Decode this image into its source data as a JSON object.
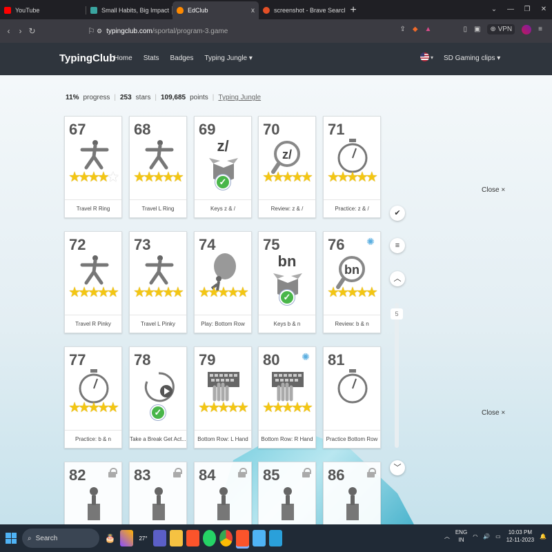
{
  "browser": {
    "tabs": [
      {
        "title": "YouTube",
        "color": "#ff0000"
      },
      {
        "title": "Small Habits, Big Impact",
        "color": "#3aa5a0"
      },
      {
        "title": "EdClub",
        "color": "#ff8a00",
        "close": "x"
      },
      {
        "title": "screenshot - Brave Search",
        "color": "#e34f26"
      }
    ],
    "new_tab": "+",
    "url_host": "typingclub.com",
    "url_path": "/sportal/program-3.game",
    "vpn_label": "VPN"
  },
  "site": {
    "brand": "TypingClub",
    "nav": [
      "Home",
      "Stats",
      "Badges",
      "Typing Jungle ▾"
    ],
    "user": "SD Gaming clips ▾",
    "flag_dropdown": "▾"
  },
  "stats": {
    "progress_value": "11%",
    "progress_label": "progress",
    "stars_value": "253",
    "stars_label": "stars",
    "points_value": "109,685",
    "points_label": "points",
    "jungle_link": "Typing Jungle"
  },
  "cards": [
    {
      "num": "67",
      "caption": "Travel R Ring",
      "stars": 4,
      "type": "stars",
      "icon": "warrior"
    },
    {
      "num": "68",
      "caption": "Travel L Ring",
      "stars": 5,
      "type": "stars",
      "icon": "warrior"
    },
    {
      "num": "69",
      "caption": "Keys z & /",
      "type": "keys",
      "keys": "z/"
    },
    {
      "num": "70",
      "caption": "Review: z & /",
      "stars": 5,
      "type": "stars",
      "icon": "magnifier",
      "keys": "z/"
    },
    {
      "num": "71",
      "caption": "Practice: z & /",
      "stars": 5,
      "type": "stars",
      "icon": "stopwatch"
    },
    {
      "num": "72",
      "caption": "Travel R Pinky",
      "stars": 5,
      "type": "stars",
      "icon": "warrior"
    },
    {
      "num": "73",
      "caption": "Travel L Pinky",
      "stars": 5,
      "type": "stars",
      "icon": "warrior"
    },
    {
      "num": "74",
      "caption": "Play: Bottom Row",
      "stars": 5,
      "type": "stars",
      "icon": "boulder"
    },
    {
      "num": "75",
      "caption": "Keys b & n",
      "type": "keys",
      "keys": "bn"
    },
    {
      "num": "76",
      "caption": "Review: b & n",
      "stars": 5,
      "type": "stars",
      "icon": "magnifier",
      "keys": "bn",
      "badge": true
    },
    {
      "num": "77",
      "caption": "Practice: b & n",
      "stars": 5,
      "type": "stars",
      "icon": "stopwatch"
    },
    {
      "num": "78",
      "caption": "Take a Break Get Act...",
      "type": "break"
    },
    {
      "num": "79",
      "caption": "Bottom Row: L Hand",
      "stars": 5,
      "type": "stars",
      "icon": "keyboard"
    },
    {
      "num": "80",
      "caption": "Bottom Row: R Hand",
      "stars": 5,
      "type": "stars",
      "icon": "keyboard",
      "badge": true
    },
    {
      "num": "81",
      "caption": "Practice Bottom Row",
      "type": "plain",
      "icon": "stopwatch"
    },
    {
      "num": "82",
      "caption": "",
      "type": "locked"
    },
    {
      "num": "83",
      "caption": "",
      "type": "locked"
    },
    {
      "num": "84",
      "caption": "",
      "type": "locked"
    },
    {
      "num": "85",
      "caption": "",
      "type": "locked"
    },
    {
      "num": "86",
      "caption": "",
      "type": "locked"
    }
  ],
  "side": {
    "scroll_page": "5",
    "close_label": "Close ×"
  },
  "taskbar": {
    "search": "Search",
    "temp": "27°",
    "lang1": "ENG",
    "lang2": "IN",
    "time": "10:03 PM",
    "date": "12-11-2023"
  },
  "colors": {
    "star": "#f3c613",
    "check": "#49b64a",
    "nav_bg": "#2f353d"
  }
}
